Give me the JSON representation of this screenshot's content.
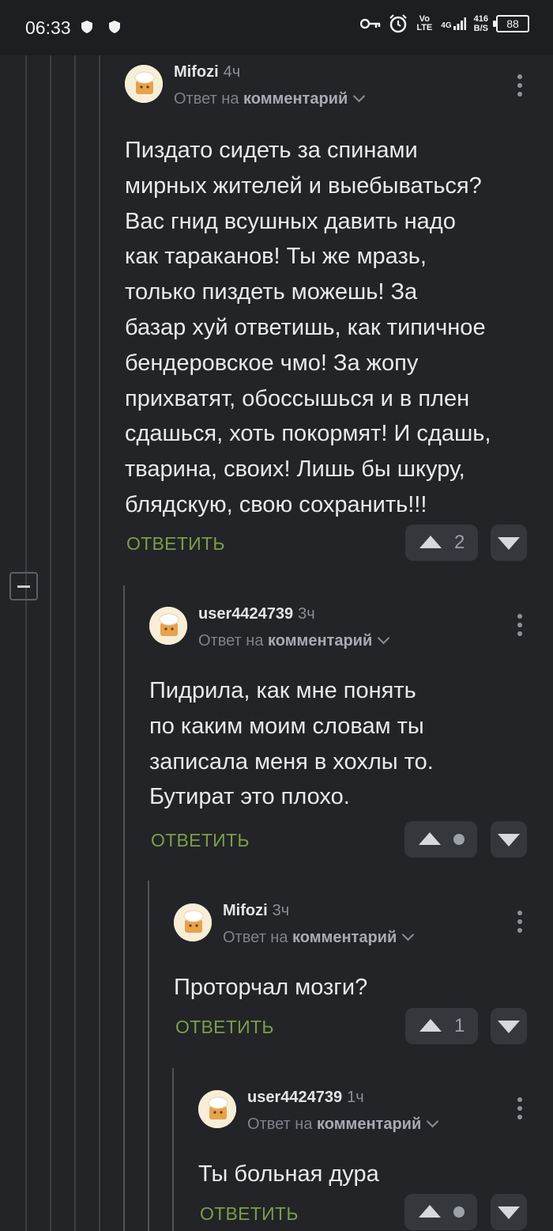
{
  "status_bar": {
    "time": "06:33",
    "network": "Vo LTE",
    "signal_label": "4G",
    "speed_value": "416",
    "speed_unit": "B/S",
    "battery": "88"
  },
  "comments": [
    {
      "author": "Mifozi",
      "time": "4ч",
      "reply_prefix": "Ответ на",
      "reply_target": "комментарий",
      "text": "Пиздато сидеть за спинами\nмирных жителей и выебываться?\nВас гнид всушных давить надо\nкак тараканов! Ты же мразь,\nтолько пиздеть можешь! За\nбазар хуй ответишь, как типичное\nбендеровское чмо! За жопу\nприхватят, обоссышься и в плен\nсдашься, хоть покормят! И сдашь,\nтварина, своих! Лишь бы шкуру,\nблядскую, свою сохранить!!!",
      "reply_label": "ОТВЕТИТЬ",
      "votes": "2"
    },
    {
      "author": "user4424739",
      "time": "3ч",
      "reply_prefix": "Ответ на",
      "reply_target": "комментарий",
      "text": "Пидрила, как мне понять\nпо каким моим словам ты\nзаписала меня в хохлы то.\nБутират это плохо.",
      "reply_label": "ОТВЕТИТЬ",
      "votes": ""
    },
    {
      "author": "Mifozi",
      "time": "3ч",
      "reply_prefix": "Ответ на",
      "reply_target": "комментарий",
      "text": "Проторчал мозги?",
      "reply_label": "ОТВЕТИТЬ",
      "votes": "1"
    },
    {
      "author": "user4424739",
      "time": "1ч",
      "reply_prefix": "Ответ на",
      "reply_target": "комментарий",
      "text": "Ты больная дура",
      "reply_label": "ОТВЕТИТЬ",
      "votes": ""
    }
  ],
  "colors": {
    "background": "#222427",
    "reply_link": "#7c9d49",
    "vote_button": "#34373c"
  },
  "icons": [
    "shield-icon",
    "key-icon",
    "alarm-icon",
    "signal-icon",
    "battery-icon",
    "more-vert-icon",
    "upvote-icon",
    "downvote-icon",
    "collapse-icon",
    "chevron-down-icon"
  ]
}
